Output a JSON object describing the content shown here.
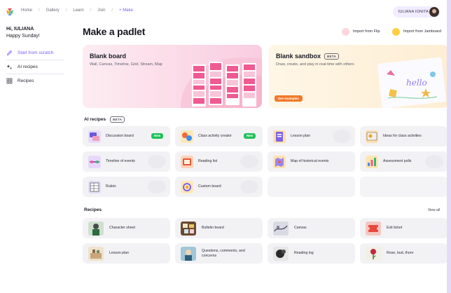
{
  "nav": {
    "breadcrumbs": [
      "Home",
      "Gallery",
      "Learn",
      "Join",
      "+ Make"
    ],
    "user_name": "IULIANA IONITA"
  },
  "sidebar": {
    "greeting": "Hi, IULIANA",
    "subgreeting": "Happy Sunday!",
    "items": [
      {
        "label": "Start from scratch",
        "icon": "pencil-icon",
        "active": true
      },
      {
        "label": "AI recipes",
        "icon": "sparkles-icon",
        "active": false
      },
      {
        "label": "Recipes",
        "icon": "grid-icon",
        "active": false
      }
    ]
  },
  "main": {
    "title": "Make a padlet",
    "import_flip": "Import from Flip",
    "import_jamboard": "Import from Jamboard",
    "blank_board": {
      "title": "Blank board",
      "subtitle": "Wall, Canvas, Timeline, Grid, Stream, Map"
    },
    "blank_sandbox": {
      "title": "Blank sandbox",
      "badge": "BETA",
      "subtitle": "Draw, create, and play in real-time with others",
      "cta": "See examples",
      "art_text": "hello"
    },
    "ai_recipes": {
      "title": "AI recipes",
      "badge": "BETA",
      "items": [
        {
          "label": "Discussion board",
          "new": "New",
          "icon": "discussion-icon"
        },
        {
          "label": "Class activity creator",
          "new": "New",
          "icon": "activity-icon"
        },
        {
          "label": "Lesson plan",
          "new": "",
          "icon": "lesson-plan-icon"
        },
        {
          "label": "Ideas for class activities",
          "new": "",
          "icon": "ideas-icon"
        },
        {
          "label": "Timeline of events",
          "new": "",
          "icon": "timeline-icon"
        },
        {
          "label": "Reading list",
          "new": "",
          "icon": "reading-list-icon"
        },
        {
          "label": "Map of historical events",
          "new": "",
          "icon": "map-icon"
        },
        {
          "label": "Assessment polls",
          "new": "",
          "icon": "polls-icon"
        },
        {
          "label": "Rubric",
          "new": "",
          "icon": "rubric-icon"
        },
        {
          "label": "Custom board",
          "new": "",
          "icon": "custom-board-icon"
        }
      ]
    },
    "recipes": {
      "title": "Recipes",
      "view_all": "View all",
      "items": [
        {
          "label": "Character sheet",
          "icon": "character-sheet-icon"
        },
        {
          "label": "Bulletin board",
          "icon": "bulletin-board-icon"
        },
        {
          "label": "Canvas",
          "icon": "canvas-icon"
        },
        {
          "label": "Exit ticket",
          "icon": "exit-ticket-icon"
        },
        {
          "label": "Lesson plan",
          "icon": "lesson-plan-recipe-icon"
        },
        {
          "label": "Questions, comments, and concerns",
          "icon": "questions-icon"
        },
        {
          "label": "Reading log",
          "icon": "reading-log-icon"
        },
        {
          "label": "Rose, bud, thorn",
          "icon": "rose-bud-thorn-icon"
        }
      ]
    }
  },
  "colors": {
    "accent": "#7a5af8",
    "new_badge": "#21c25a",
    "see_examples": "#f07a2a",
    "blank_board_bg": "#fbd9e6",
    "sandbox_bg": "#fdeed4"
  }
}
